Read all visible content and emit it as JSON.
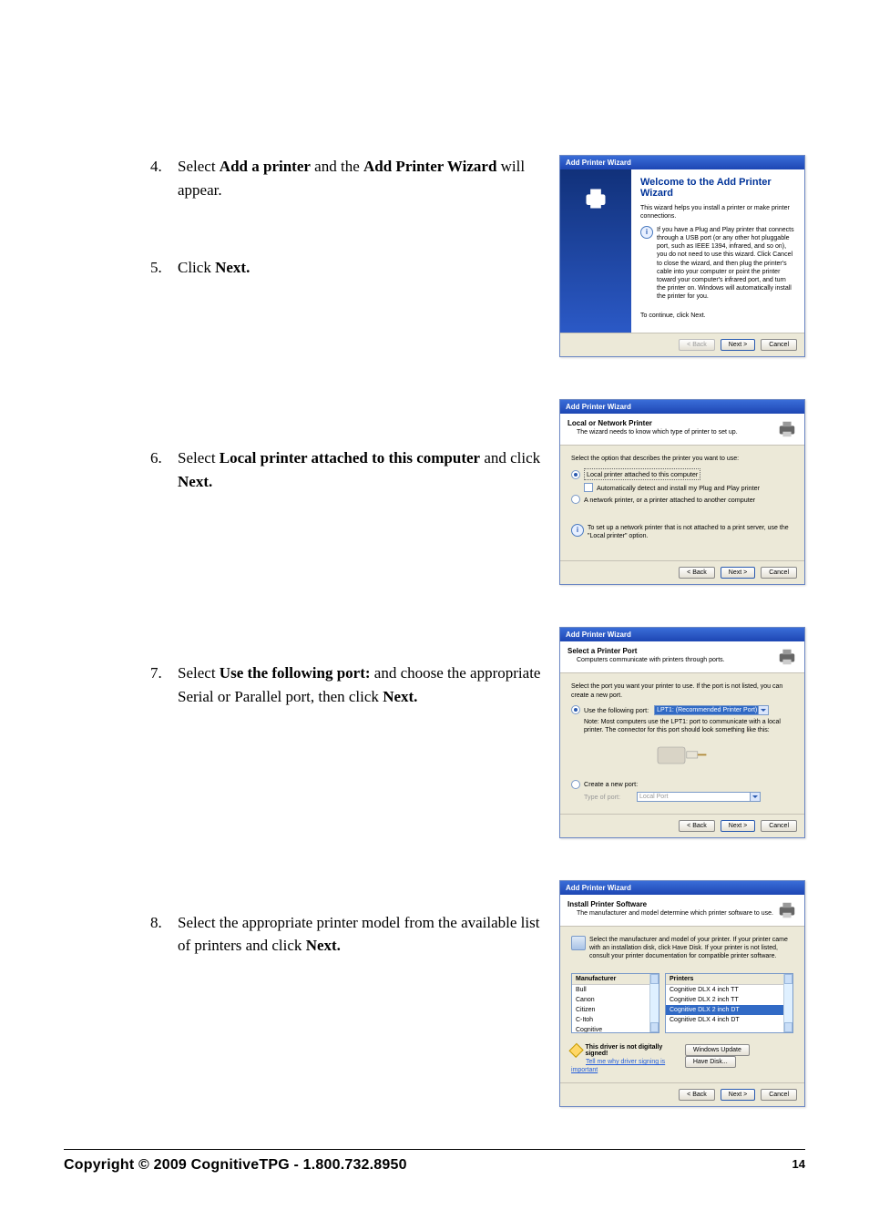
{
  "steps": {
    "s4": {
      "num": "4.",
      "t1": "Select ",
      "b1": "Add a printer",
      "t2": " and the ",
      "b2": "Add Printer Wizard",
      "t3": " will appear."
    },
    "s5": {
      "num": "5.",
      "t1": "Click ",
      "b1": "Next."
    },
    "s6": {
      "num": "6.",
      "t1": "Select ",
      "b1": "Local printer attached to this computer",
      "t2": " and click ",
      "b2": "Next."
    },
    "s7": {
      "num": "7.",
      "t1": "Select ",
      "b1": "Use the following port:",
      "t2": " and choose the appropriate Serial or Parallel port, then click ",
      "b2": "Next."
    },
    "s8": {
      "num": "8.",
      "t1": "  Select the appropriate printer model from the available list of printers and click ",
      "b1": "Next."
    }
  },
  "wiz": {
    "title": "Add Printer Wizard",
    "btn_back": "< Back",
    "btn_next": "Next >",
    "btn_cancel": "Cancel",
    "btn_wu": "Windows Update",
    "btn_hd": "Have Disk..."
  },
  "w1": {
    "heading": "Welcome to the Add Printer Wizard",
    "p1": "This wizard helps you install a printer or make printer connections.",
    "info": "If you have a Plug and Play printer that connects through a USB port (or any other hot pluggable port, such as IEEE 1394, infrared, and so on), you do not need to use this wizard. Click Cancel to close the wizard, and then plug the printer's cable into your computer or point the printer toward your computer's infrared port, and turn the printer on. Windows will automatically install the printer for you.",
    "p2": "To continue, click Next."
  },
  "w2": {
    "h": "Local or Network Printer",
    "sub": "The wizard needs to know which type of printer to set up.",
    "lead": "Select the option that describes the printer you want to use:",
    "r1": "Local printer attached to this computer",
    "c1": "Automatically detect and install my Plug and Play printer",
    "r2": "A network printer, or a printer attached to another computer",
    "tip": "To set up a network printer that is not attached to a print server, use the \"Local printer\" option."
  },
  "w3": {
    "h": "Select a Printer Port",
    "sub": "Computers communicate with printers through ports.",
    "lead": "Select the port you want your printer to use. If the port is not listed, you can create a new port.",
    "r1": "Use the following port:",
    "dd": "LPT1: (Recommended Printer Port)",
    "note": "Note: Most computers use the LPT1: port to communicate with a local printer. The connector for this port should look something like this:",
    "r2": "Create a new port:",
    "r2lab": "Type of port:",
    "dd2": "Local Port"
  },
  "w4": {
    "h": "Install Printer Software",
    "sub": "The manufacturer and model determine which printer software to use.",
    "lead": "Select the manufacturer and model of your printer. If your printer came with an installation disk, click Have Disk. If your printer is not listed, consult your printer documentation for compatible printer software.",
    "mfg_h": "Manufacturer",
    "prn_h": "Printers",
    "mfg": [
      "Bull",
      "Canon",
      "Citizen",
      "C-Itoh",
      "Cognitive"
    ],
    "prn": [
      "Cognitive DLX 4 inch TT",
      "Cognitive DLX 2 inch TT",
      "Cognitive DLX 2 inch DT",
      "Cognitive DLX 4 inch DT"
    ],
    "prn_sel_index": 2,
    "warn": "This driver is not digitally signed!",
    "why": "Tell me why driver signing is important"
  },
  "footer": {
    "copy": "Copyright © 2009 CognitiveTPG - 1.800.732.8950",
    "page": "14"
  }
}
